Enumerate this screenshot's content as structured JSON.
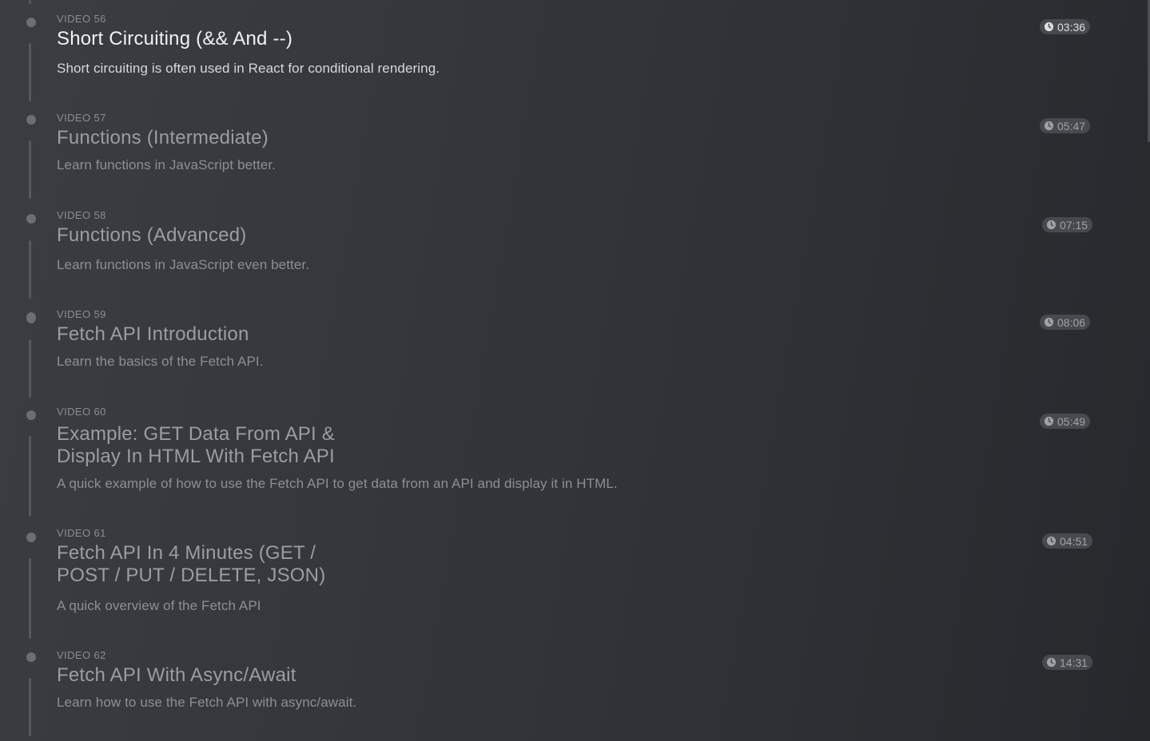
{
  "videos": [
    {
      "label": "VIDEO 56",
      "title": "Short Circuiting (&& And --)",
      "description": "Short circuiting is often used in React for conditional rendering.",
      "duration": "03:36",
      "active": true
    },
    {
      "label": "VIDEO 57",
      "title": "Functions (Intermediate)",
      "description": "Learn functions in JavaScript better.",
      "duration": "05:47",
      "active": false
    },
    {
      "label": "VIDEO 58",
      "title": "Functions (Advanced)",
      "description": "Learn functions in JavaScript even better.",
      "duration": "07:15",
      "active": false
    },
    {
      "label": "VIDEO 59",
      "title": "Fetch API Introduction",
      "description": "Learn the basics of the Fetch API.",
      "duration": "08:06",
      "active": false
    },
    {
      "label": "VIDEO 60",
      "title": "Example: GET Data From API & Display In HTML With Fetch API",
      "description": "A quick example of how to use the Fetch API to get data from an API and display it in HTML.",
      "duration": "05:49",
      "active": false
    },
    {
      "label": "VIDEO 61",
      "title": "Fetch API In 4 Minutes (GET / POST / PUT / DELETE, JSON)",
      "description": "A quick overview of the Fetch API",
      "duration": "04:51",
      "active": false
    },
    {
      "label": "VIDEO 62",
      "title": "Fetch API With Async/Await",
      "description": "Learn how to use the Fetch API with async/await.",
      "duration": "14:31",
      "active": false
    }
  ],
  "icons": {
    "duration": "clock-icon",
    "marker": "timeline-dot"
  },
  "colors": {
    "background": "#33363b",
    "active_text": "#f0f1f2",
    "muted_text": "#9a9da1",
    "badge": "#47494e"
  }
}
